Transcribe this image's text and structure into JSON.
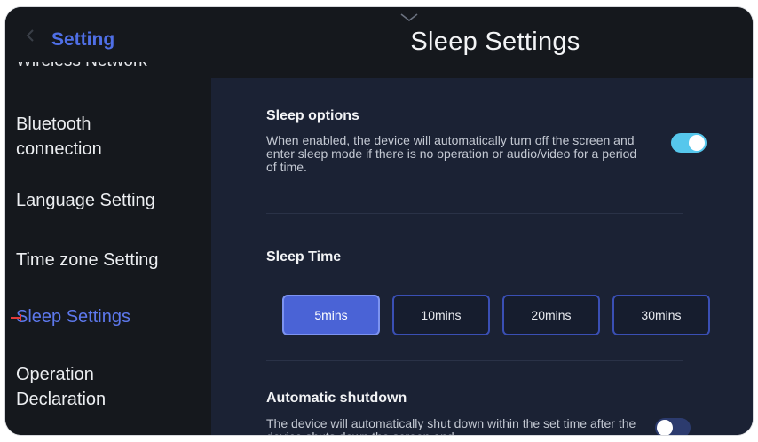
{
  "sidebar": {
    "title": "Setting",
    "partial_item": "Wireless Network",
    "items": [
      {
        "label": "Bluetooth\nconnection"
      },
      {
        "label": "Language Setting"
      },
      {
        "label": "Time zone Setting"
      },
      {
        "label": "Sleep Settings",
        "active": true
      },
      {
        "label": "Operation\nDeclaration"
      }
    ]
  },
  "header": {
    "title": "Sleep Settings"
  },
  "sleep_options": {
    "title": "Sleep options",
    "description": "When enabled, the device will automatically turn off the screen and enter sleep mode if there is no operation or audio/video for a period of time.",
    "enabled": true
  },
  "sleep_time": {
    "title": "Sleep Time",
    "options": [
      "5mins",
      "10mins",
      "20mins",
      "30mins"
    ],
    "selected": "5mins"
  },
  "auto_shutdown": {
    "title": "Automatic shutdown",
    "description": "The device will automatically shut down within the set time after the device shuts down the screen and",
    "enabled": false
  },
  "colors": {
    "accent": "#4f6fe6",
    "toggle_on": "#56c7ec",
    "toggle_off": "#2c3b6e",
    "panel_bg": "#1b2234",
    "app_bg": "#15181d"
  }
}
